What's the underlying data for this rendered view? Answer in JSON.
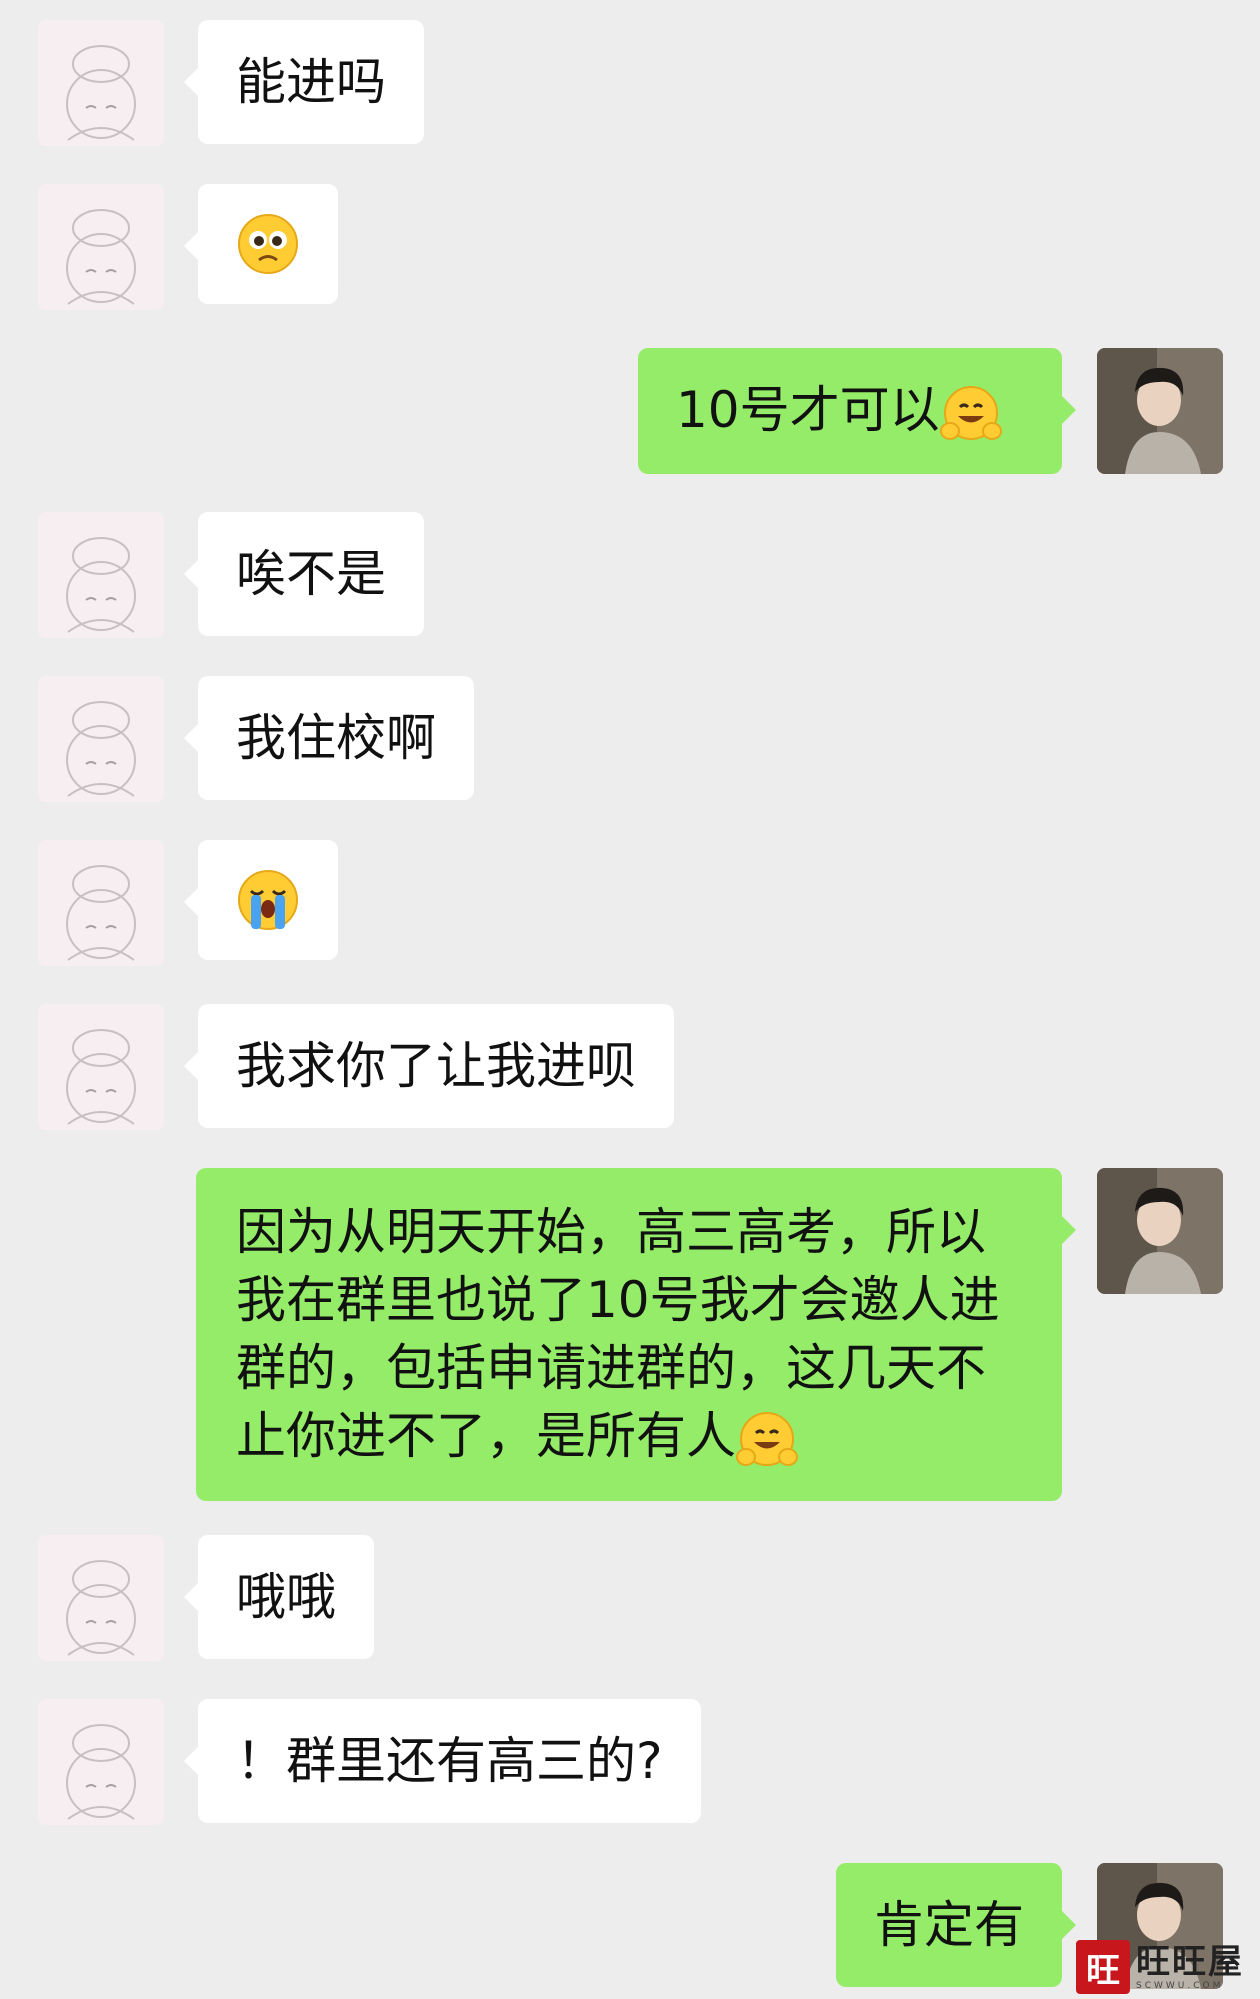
{
  "messages": [
    {
      "side": "in",
      "text": "能进吗"
    },
    {
      "side": "in",
      "emoji": "pleading-face"
    },
    {
      "side": "out",
      "text": "10号才可以",
      "trailing_emoji": "smiling-hands-emoji"
    },
    {
      "side": "in",
      "text": "唉不是"
    },
    {
      "side": "in",
      "text": "我住校啊"
    },
    {
      "side": "in",
      "emoji": "loudly-crying-face"
    },
    {
      "side": "in",
      "text": "我求你了让我进呗"
    },
    {
      "side": "out",
      "text": "因为从明天开始，高三高考，所以我在群里也说了10号我才会邀人进群的，包括申请进群的，这几天不止你进不了，是所有人",
      "trailing_emoji": "smiling-hands-emoji"
    },
    {
      "side": "in",
      "text": "哦哦"
    },
    {
      "side": "in",
      "text": "！群里还有高三的?"
    },
    {
      "side": "out",
      "text": "肯定有"
    }
  ],
  "colors": {
    "background": "#ededed",
    "incoming_bubble": "#ffffff",
    "outgoing_bubble": "#95ec69",
    "watermark_red": "#c8161d"
  },
  "watermark": {
    "main": "旺旺屋",
    "sub": "SCWWU.COM",
    "seal": "旺"
  }
}
